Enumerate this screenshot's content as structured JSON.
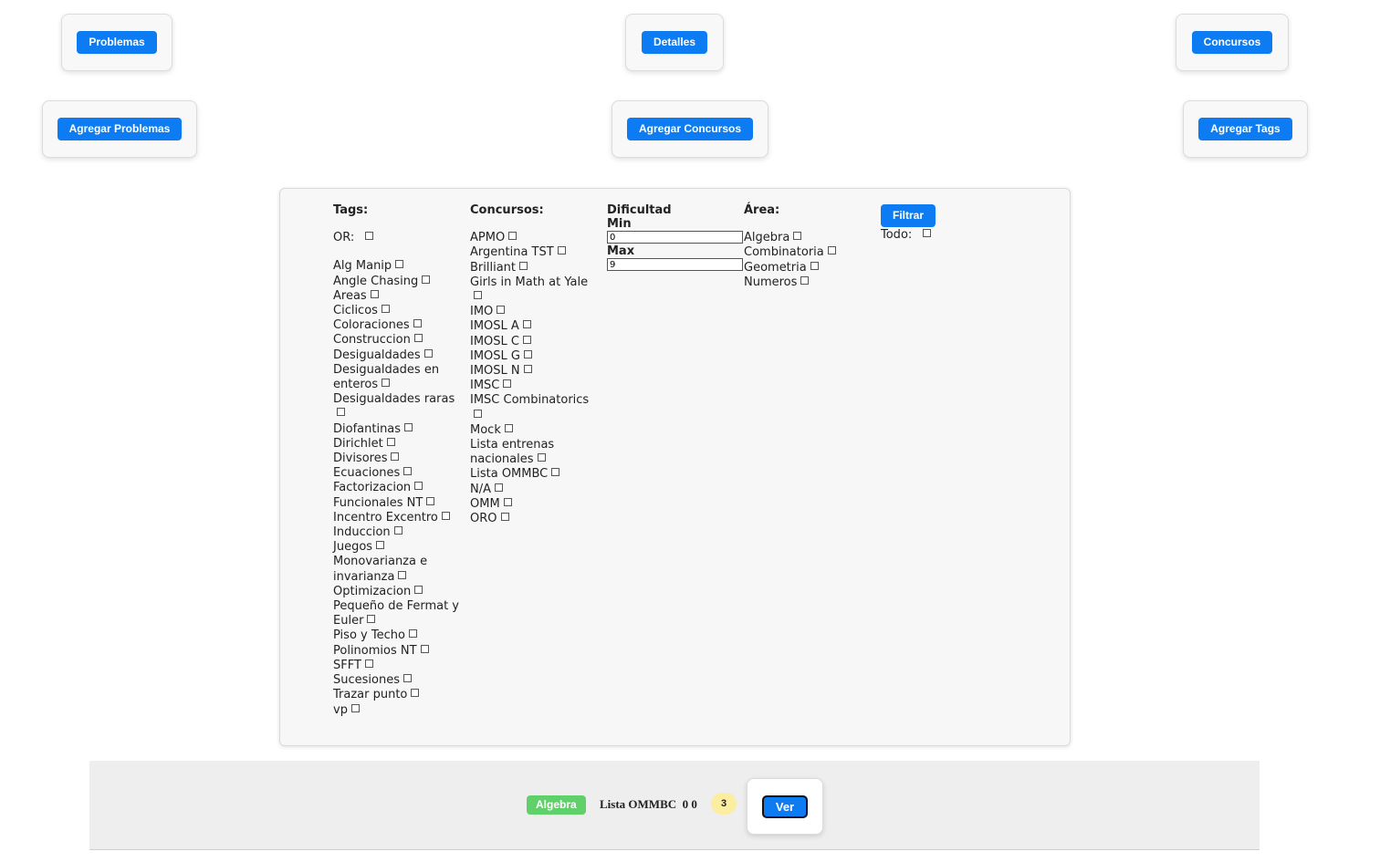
{
  "nav": {
    "problemas": "Problemas",
    "detalles": "Detalles",
    "concursos": "Concursos",
    "agregar_problemas": "Agregar Problemas",
    "agregar_concursos": "Agregar Concursos",
    "agregar_tags": "Agregar Tags"
  },
  "filters": {
    "tags_title": "Tags:",
    "or_label": "OR:",
    "tags": [
      "Alg Manip",
      "Angle Chasing",
      "Areas",
      "Ciclicos",
      "Coloraciones",
      "Construccion",
      "Desigualdades",
      "Desigualdades en enteros",
      "Desigualdades raras",
      "Diofantinas",
      "Dirichlet",
      "Divisores",
      "Ecuaciones",
      "Factorizacion",
      "Funcionales NT",
      "Incentro Excentro",
      "Induccion",
      "Juegos",
      "Monovarianza e invarianza",
      "Optimizacion",
      "Pequeño de Fermat y Euler",
      "Piso y Techo",
      "Polinomios NT",
      "SFFT",
      "Sucesiones",
      "Trazar punto",
      "vp"
    ],
    "concursos_title": "Concursos:",
    "concursos": [
      "APMO",
      "Argentina TST",
      "Brilliant",
      "Girls in Math at Yale",
      "IMO",
      "IMOSL A",
      "IMOSL C",
      "IMOSL G",
      "IMOSL N",
      "IMSC",
      "IMSC Combinatorics",
      "Mock",
      "Lista entrenas nacionales",
      "Lista OMMBC",
      "N/A",
      "OMM",
      "ORO"
    ],
    "dificultad_title": "Dificultad",
    "min_label": "Min",
    "min_value": "0",
    "max_label": "Max",
    "max_value": "9",
    "area_title": "Área:",
    "areas": [
      "Algebra",
      "Combinatoria",
      "Geometria",
      "Numeros"
    ],
    "filtrar_label": "Filtrar",
    "todo_label": "Todo:"
  },
  "result": {
    "area_badge": "Algebra",
    "text": "Lista OMMBC  0 0",
    "count": "3",
    "ver_label": "Ver",
    "colors": {
      "badge_green": "#60d06a",
      "count_yellow": "#fbeea0",
      "button_blue": "#0d7cf2"
    }
  }
}
